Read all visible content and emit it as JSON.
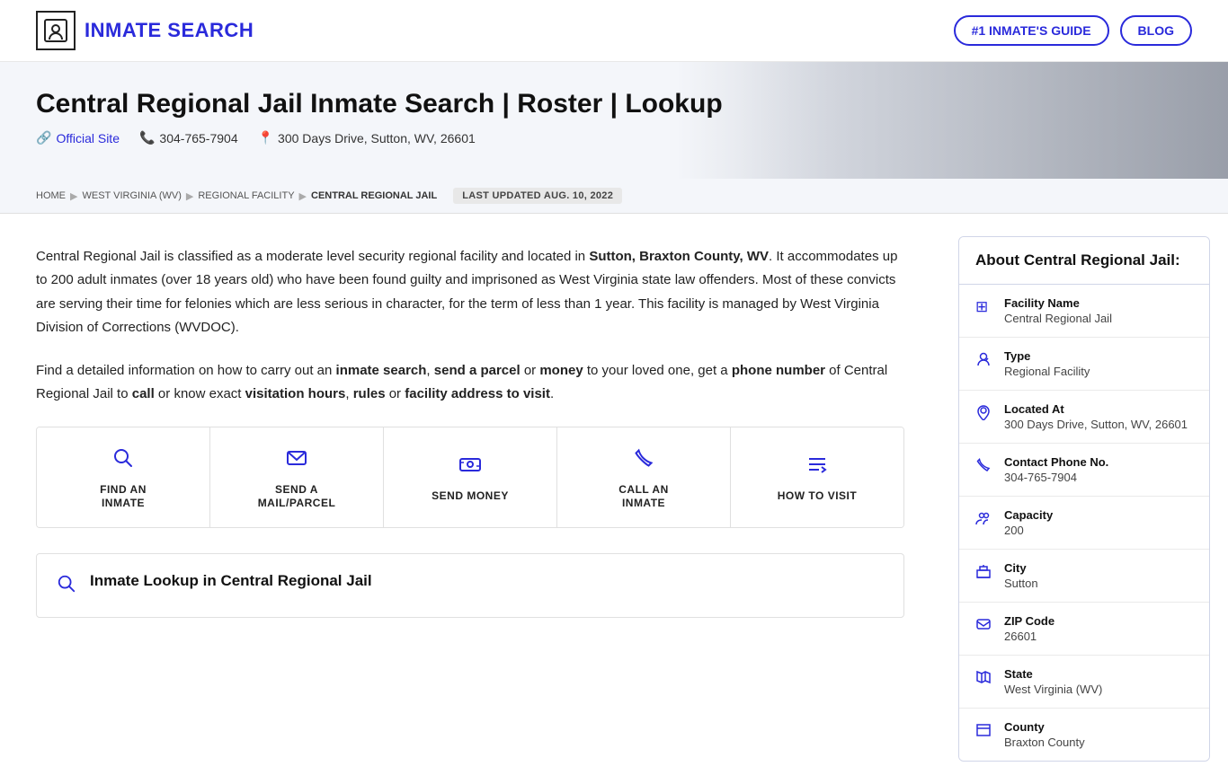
{
  "header": {
    "logo_text": "INMATE SEARCH",
    "nav_guide_label": "#1 INMATE'S GUIDE",
    "nav_blog_label": "BLOG"
  },
  "hero": {
    "title": "Central Regional Jail Inmate Search | Roster | Lookup",
    "official_site_label": "Official Site",
    "phone_label": "304-765-7904",
    "address_label": "300 Days Drive, Sutton, WV, 26601"
  },
  "breadcrumb": {
    "home": "HOME",
    "state": "WEST VIRGINIA (WV)",
    "type": "REGIONAL FACILITY",
    "current": "CENTRAL REGIONAL JAIL",
    "last_updated": "LAST UPDATED AUG. 10, 2022"
  },
  "content": {
    "paragraph1": "Central Regional Jail is classified as a moderate level security regional facility and located in Sutton, Braxton County, WV. It accommodates up to 200 adult inmates (over 18 years old) who have been found guilty and imprisoned as West Virginia state law offenders. Most of these convicts are serving their time for felonies which are less serious in character, for the term of less than 1 year. This facility is managed by West Virginia Division of Corrections (WVDOC).",
    "paragraph1_bold1": "Sutton, Braxton County, WV",
    "paragraph2_intro": "Find a detailed information on how to carry out an ",
    "paragraph2_bold1": "inmate search",
    "paragraph2_mid1": ", ",
    "paragraph2_bold2": "send a parcel",
    "paragraph2_mid2": " or ",
    "paragraph2_bold3": "money",
    "paragraph2_mid3": " to your loved one, get a ",
    "paragraph2_bold4": "phone number",
    "paragraph2_mid4": " of Central Regional Jail to ",
    "paragraph2_bold5": "call",
    "paragraph2_mid5": " or know exact ",
    "paragraph2_bold6": "visitation hours",
    "paragraph2_mid6": ", ",
    "paragraph2_bold7": "rules",
    "paragraph2_mid7": " or ",
    "paragraph2_bold8": "facility address to visit",
    "paragraph2_end": "."
  },
  "action_cards": [
    {
      "icon": "🔍",
      "label": "FIND AN\nINMATE"
    },
    {
      "icon": "✉",
      "label": "SEND A\nMAIL/PARCEL"
    },
    {
      "icon": "💳",
      "label": "SEND MONEY"
    },
    {
      "icon": "📞",
      "label": "CALL AN\nINMATE"
    },
    {
      "icon": "≡",
      "label": "HOW TO VISIT"
    }
  ],
  "lookup_section": {
    "title": "Inmate Lookup in Central Regional Jail"
  },
  "sidebar": {
    "header": "About Central Regional Jail:",
    "rows": [
      {
        "icon": "⊞",
        "label": "Facility Name",
        "value": "Central Regional Jail"
      },
      {
        "icon": "🔑",
        "label": "Type",
        "value": "Regional Facility"
      },
      {
        "icon": "📍",
        "label": "Located At",
        "value": "300 Days Drive, Sutton, WV, 26601"
      },
      {
        "icon": "📱",
        "label": "Contact Phone No.",
        "value": "304-765-7904"
      },
      {
        "icon": "👥",
        "label": "Capacity",
        "value": "200"
      },
      {
        "icon": "🏛",
        "label": "City",
        "value": "Sutton"
      },
      {
        "icon": "✉",
        "label": "ZIP Code",
        "value": "26601"
      },
      {
        "icon": "🗺",
        "label": "State",
        "value": "West Virginia (WV)"
      },
      {
        "icon": "📋",
        "label": "County",
        "value": "Braxton County"
      }
    ]
  }
}
